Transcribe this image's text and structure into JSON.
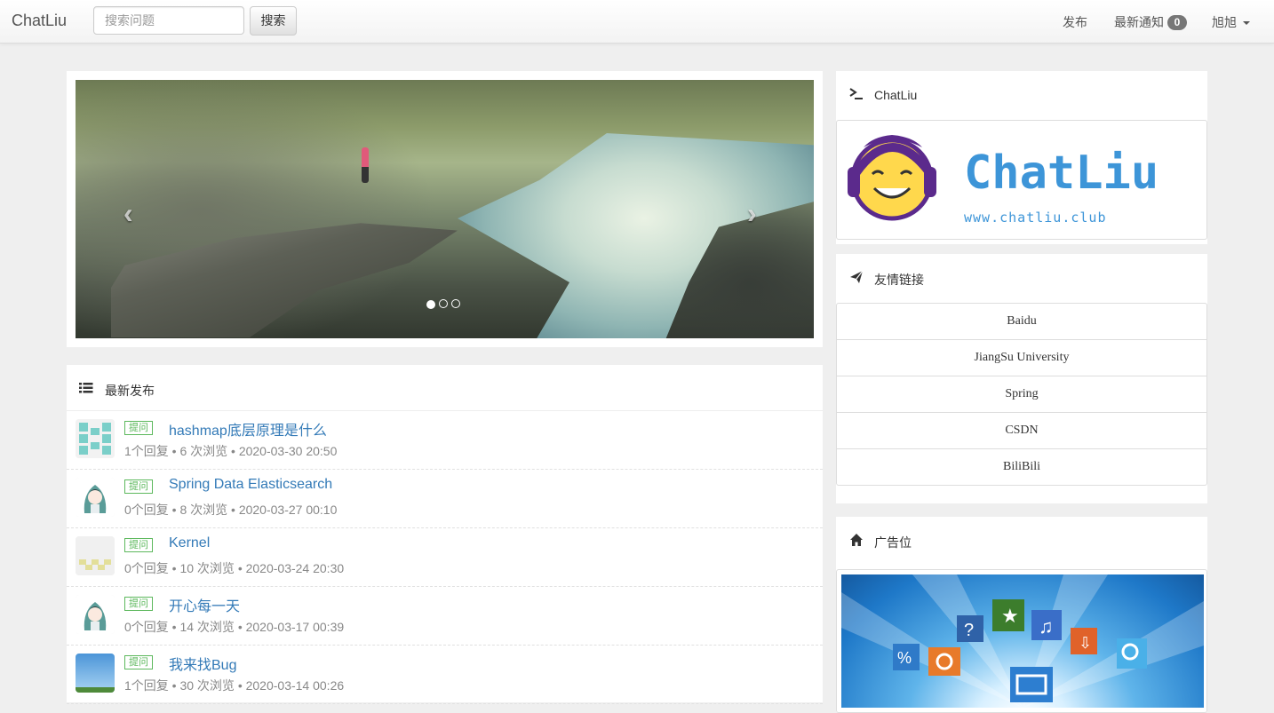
{
  "navbar": {
    "brand": "ChatLiu",
    "search_placeholder": "搜索问题",
    "search_button": "搜索",
    "publish": "发布",
    "notifications": "最新通知",
    "notification_count": "0",
    "user": "旭旭"
  },
  "carousel": {
    "prev_icon": "‹",
    "next_icon": "›",
    "slide_count": 3,
    "active_slide": 1
  },
  "posts": {
    "heading": "最新发布",
    "items": [
      {
        "tag": "提问",
        "title": "hashmap底层原理是什么",
        "meta": "1个回复 • 6 次浏览 • 2020-03-30 20:50",
        "avatar": "identicon-teal"
      },
      {
        "tag": "提问",
        "title": "Spring Data Elasticsearch",
        "meta": "0个回复 • 8 次浏览 • 2020-03-27 00:10",
        "avatar": "anime-girl"
      },
      {
        "tag": "提问",
        "title": "Kernel",
        "meta": "0个回复 • 10 次浏览 • 2020-03-24 20:30",
        "avatar": "identicon-yellow"
      },
      {
        "tag": "提问",
        "title": "开心每一天",
        "meta": "0个回复 • 14 次浏览 • 2020-03-17 00:39",
        "avatar": "anime-girl"
      },
      {
        "tag": "提问",
        "title": "我来找Bug",
        "meta": "1个回复 • 30 次浏览 • 2020-03-14 00:26",
        "avatar": "sky-photo"
      }
    ]
  },
  "sidebar": {
    "brand_heading": "ChatLiu",
    "logo_text": "ChatLiu",
    "logo_url": "www.chatliu.club",
    "links_heading": "友情链接",
    "links": [
      "Baidu",
      "JiangSu University",
      "Spring",
      "CSDN",
      "BiliBili"
    ],
    "ad_heading": "广告位"
  },
  "colors": {
    "link": "#337ab7",
    "tag": "#5cb85c",
    "logo_blue": "#3d95d8",
    "logo_purple": "#5b2a8c"
  }
}
